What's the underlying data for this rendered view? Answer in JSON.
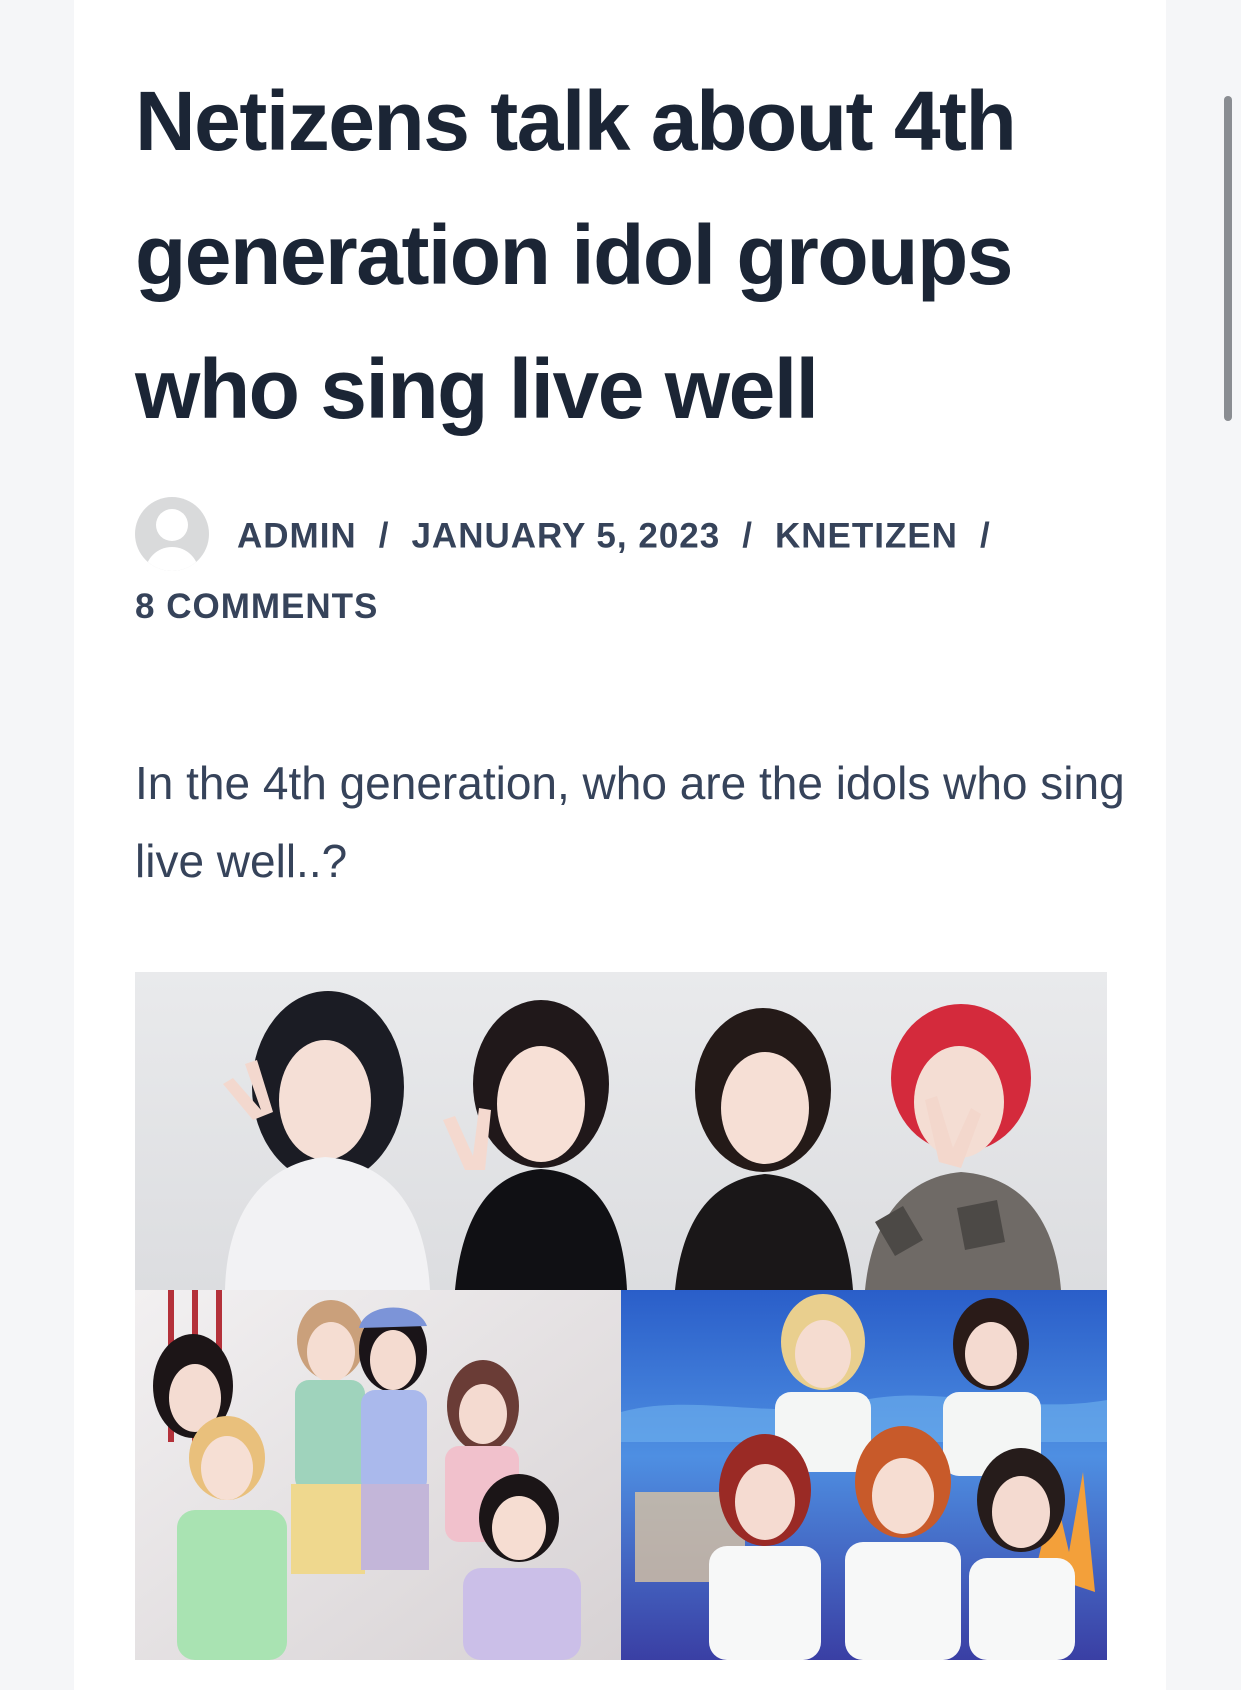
{
  "article": {
    "title": "Netizens talk about 4th generation idol groups who sing live well",
    "author": "ADMIN",
    "date": "JANUARY 5, 2023",
    "category": "KNETIZEN",
    "comments": "8 COMMENTS",
    "separator": "/",
    "lead": "In the 4th generation, who are the idols who sing live well..?"
  },
  "icons": {
    "avatar": "default-user-avatar-icon"
  },
  "colors": {
    "title": "#1b2535",
    "text": "#36435a",
    "page_background": "#f5f6f8",
    "card_background": "#ffffff"
  }
}
